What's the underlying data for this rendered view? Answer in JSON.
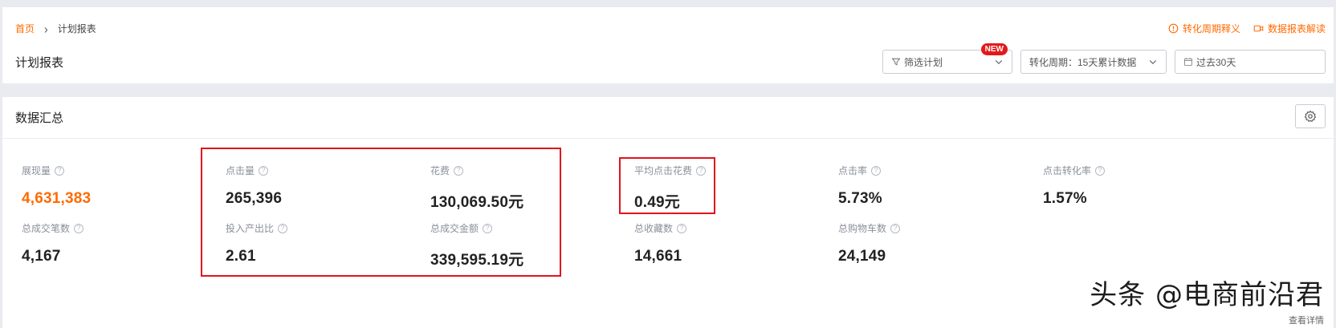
{
  "breadcrumb": {
    "home": "首页",
    "separator": "›",
    "current": "计划报表"
  },
  "page_title": "计划报表",
  "top_links": {
    "cycle_explain": "转化周期释义",
    "report_explain": "数据报表解读"
  },
  "filters": {
    "plan": {
      "label": "筛选计划",
      "badge": "NEW"
    },
    "cycle": {
      "label": "转化周期：15天累计数据"
    },
    "date": {
      "label": "过去30天"
    }
  },
  "summary": {
    "title": "数据汇总",
    "metrics": [
      {
        "label": "展现量",
        "value": "4,631,383",
        "unit": ""
      },
      {
        "label": "点击量",
        "value": "265,396",
        "unit": ""
      },
      {
        "label": "花费",
        "value": "130,069.50",
        "unit": "元"
      },
      {
        "label": "平均点击花费",
        "value": "0.49",
        "unit": "元"
      },
      {
        "label": "点击率",
        "value": "5.73%",
        "unit": ""
      },
      {
        "label": "点击转化率",
        "value": "1.57%",
        "unit": ""
      },
      {
        "label": "总成交笔数",
        "value": "4,167",
        "unit": ""
      },
      {
        "label": "投入产出比",
        "value": "2.61",
        "unit": ""
      },
      {
        "label": "总成交金额",
        "value": "339,595.19",
        "unit": "元"
      },
      {
        "label": "总收藏数",
        "value": "14,661",
        "unit": ""
      },
      {
        "label": "总购物车数",
        "value": "24,149",
        "unit": ""
      }
    ],
    "detail_link": "查看详情"
  },
  "watermark": "头条 @电商前沿君",
  "colors": {
    "accent": "#ff6a00",
    "highlight_box": "#e0141e",
    "badge": "#e21a1a"
  }
}
